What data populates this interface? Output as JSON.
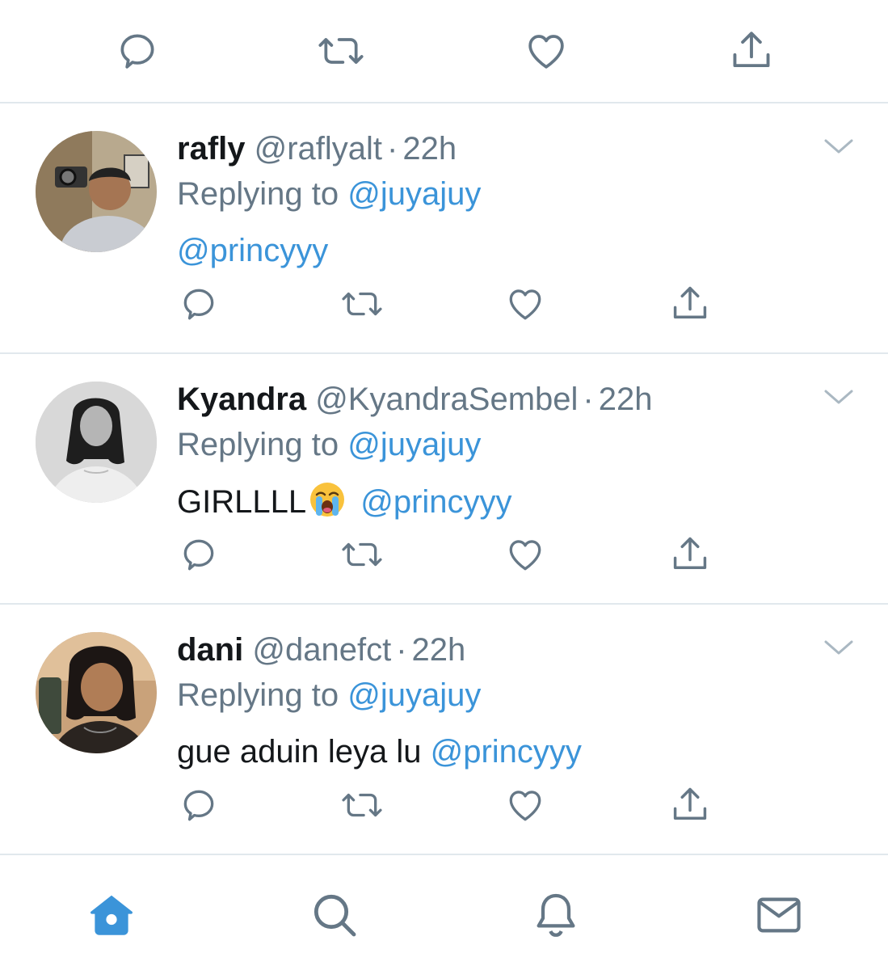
{
  "colors": {
    "accent": "#3b94d9",
    "icon_gray": "#657786",
    "text": "#14171a",
    "divider": "#e1e8ed"
  },
  "tweets": [
    {
      "name": "rafly",
      "handle": "@raflyalt",
      "separator": "·",
      "time": "22h",
      "replying_prefix": "Replying to",
      "replying_to": "@juyajuy",
      "text": "",
      "mention": "@princyyy"
    },
    {
      "name": "Kyandra",
      "handle": "@KyandraSembel",
      "separator": "·",
      "time": "22h",
      "replying_prefix": "Replying to",
      "replying_to": "@juyajuy",
      "text": "GIRLLLL",
      "emoji": "loudly-crying-face",
      "mention": "@princyyy"
    },
    {
      "name": "dani",
      "handle": "@danefct",
      "separator": "·",
      "time": "22h",
      "replying_prefix": "Replying to",
      "replying_to": "@juyajuy",
      "text": "gue aduin leya lu",
      "mention": "@princyyy"
    }
  ],
  "tab_icons": [
    "home-icon",
    "search-icon",
    "notifications-icon",
    "messages-icon"
  ],
  "action_icons": [
    "reply-icon",
    "retweet-icon",
    "like-icon",
    "share-icon"
  ]
}
